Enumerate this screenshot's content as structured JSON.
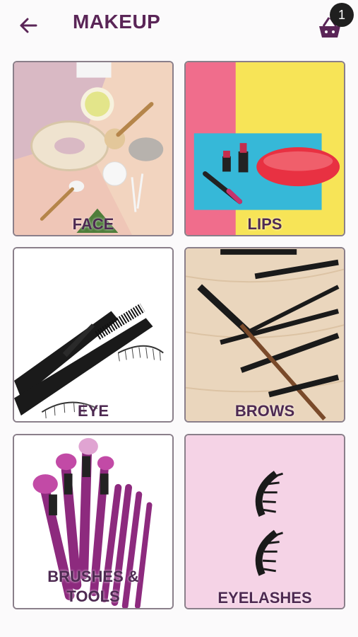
{
  "header": {
    "title": "MAKEUP",
    "cart_count": "1"
  },
  "categories": [
    {
      "label": "FACE"
    },
    {
      "label": "LIPS"
    },
    {
      "label": "EYE"
    },
    {
      "label": "BROWS"
    },
    {
      "label": "BRUSHES & TOOLS"
    },
    {
      "label": "EYELASHES"
    }
  ],
  "colors": {
    "brand": "#5a2557",
    "tile_border": "#8a7f8a",
    "background": "#fbfafb"
  }
}
